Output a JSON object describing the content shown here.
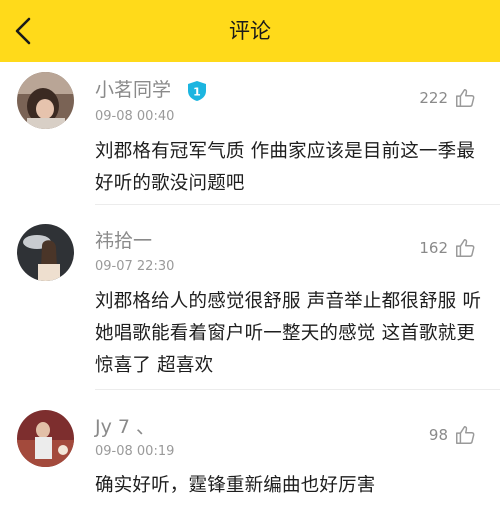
{
  "header": {
    "title": "评论",
    "back_icon": "chevron-left-icon",
    "background": "#ffda1a"
  },
  "comments": [
    {
      "username": "小茗同学",
      "badge_icon": "vip-shield-icon",
      "badge_text": "1",
      "timestamp": "09-08 00:40",
      "likes": "222",
      "text": "刘郡格有冠军气质 作曲家应该是目前这一季最好听的歌没问题吧"
    },
    {
      "username": "祎拾一",
      "timestamp": "09-07 22:30",
      "likes": "162",
      "text": "刘郡格给人的感觉很舒服 声音举止都很舒服 听她唱歌能看着窗户听一整天的感觉 这首歌就更惊喜了 超喜欢"
    },
    {
      "username": "Jy 7 、",
      "timestamp": "09-08 00:19",
      "likes": "98",
      "text": "确实好听，霆锋重新编曲也好厉害"
    }
  ],
  "like_icon": "thumbs-up-icon",
  "colors": {
    "accent": "#ffda1a",
    "badge": "#1cb5e0",
    "muted_text": "#8a8a8a"
  }
}
